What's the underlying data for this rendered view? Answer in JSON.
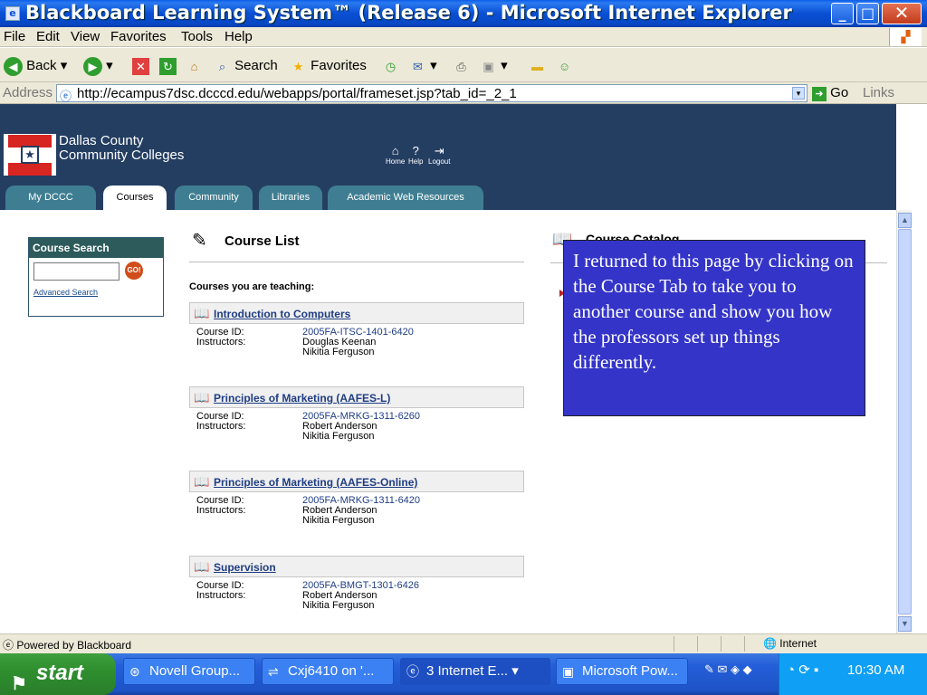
{
  "window": {
    "title": "Blackboard Learning System™ (Release 6) - Microsoft Internet Explorer",
    "min": "_",
    "max": "□",
    "close": "✕"
  },
  "menu": [
    "File",
    "Edit",
    "View",
    "Favorites",
    "Tools",
    "Help"
  ],
  "toolbar": {
    "back": "Back",
    "search": "Search",
    "favorites": "Favorites"
  },
  "address": {
    "label": "Address",
    "url": "http://ecampus7dsc.dcccd.edu/webapps/portal/frameset.jsp?tab_id=_2_1",
    "go": "Go",
    "links": "Links"
  },
  "header": {
    "college_line1": "Dallas County",
    "college_line2": "Community Colleges",
    "home": "Home",
    "help": "Help",
    "logout": "Logout"
  },
  "tabs": [
    "My DCCC",
    "Courses",
    "Community",
    "Libraries",
    "Academic Web Resources"
  ],
  "course_search": {
    "title": "Course Search",
    "go": "GO!",
    "advanced": "Advanced Search"
  },
  "course_list": {
    "title": "Course List",
    "teaching_label": "Courses you are teaching:",
    "id_label": "Course ID:",
    "instructors_label": "Instructors:",
    "courses": [
      {
        "name": "Introduction to Computers",
        "id": "2005FA-ITSC-1401-6420",
        "instructors": [
          "Douglas Keenan",
          "Nikitia Ferguson"
        ]
      },
      {
        "name": "Principles of Marketing (AAFES-L)",
        "id": "2005FA-MRKG-1311-6260",
        "instructors": [
          "Robert Anderson",
          "Nikitia Ferguson"
        ]
      },
      {
        "name": "Principles of Marketing (AAFES-Online)",
        "id": "2005FA-MRKG-1311-6420",
        "instructors": [
          "Robert Anderson",
          "Nikitia Ferguson"
        ]
      },
      {
        "name": "Supervision",
        "id": "2005FA-BMGT-1301-6426",
        "instructors": [
          "Robert Anderson",
          "Nikitia Ferguson"
        ]
      }
    ]
  },
  "catalog": {
    "title": "Course Catalog"
  },
  "overlay_note": "I returned to this page by clicking on the Course Tab to take you to another course and show you how the professors set up things differently.",
  "status": {
    "left": "Powered by Blackboard",
    "zone": "Internet"
  },
  "taskbar": {
    "start": "start",
    "tasks": [
      "Novell Group...",
      "Cxj6410 on '...",
      "3 Internet E...",
      "Microsoft Pow..."
    ],
    "time": "10:30 AM"
  }
}
